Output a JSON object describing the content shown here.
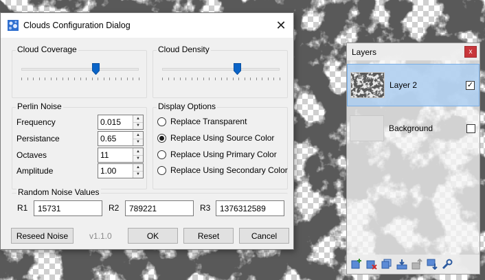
{
  "dialog": {
    "title": "Clouds Configuration Dialog",
    "close_glyph": "✕",
    "coverage": {
      "label": "Cloud Coverage",
      "value_fraction": 0.63
    },
    "density": {
      "label": "Cloud Density",
      "value_fraction": 0.64
    },
    "perlin": {
      "label": "Perlin Noise",
      "fields": [
        {
          "label": "Frequency",
          "value": "0.015"
        },
        {
          "label": "Persistance",
          "value": "0.65"
        },
        {
          "label": "Octaves",
          "value": "11"
        },
        {
          "label": "Amplitude",
          "value": "1.00"
        }
      ]
    },
    "display": {
      "label": "Display Options",
      "options": [
        {
          "label": "Replace Transparent",
          "selected": false
        },
        {
          "label": "Replace Using Source Color",
          "selected": true
        },
        {
          "label": "Replace Using Primary Color",
          "selected": false
        },
        {
          "label": "Replace Using Secondary Color",
          "selected": false
        }
      ]
    },
    "random": {
      "label": "Random Noise Values",
      "r1_label": "R1",
      "r1": "15731",
      "r2_label": "R2",
      "r2": "789221",
      "r3_label": "R3",
      "r3": "1376312589"
    },
    "buttons": {
      "reseed": "Reseed Noise",
      "ok": "OK",
      "reset": "Reset",
      "cancel": "Cancel"
    },
    "version": "v1.1.0"
  },
  "layers": {
    "title": "Layers",
    "close_glyph": "x",
    "items": [
      {
        "name": "Layer 2",
        "visible": true,
        "selected": true
      },
      {
        "name": "Background",
        "visible": false,
        "selected": false
      }
    ],
    "tools": [
      "add-layer-icon",
      "delete-layer-icon",
      "duplicate-layer-icon",
      "merge-down-icon",
      "move-up-icon",
      "move-down-icon",
      "layer-properties-icon"
    ]
  },
  "colors": {
    "accent": "#0a64c8",
    "selection": "#adcef0",
    "close_red": "#c8363b",
    "cloud_dark": "#1c1c1c"
  }
}
